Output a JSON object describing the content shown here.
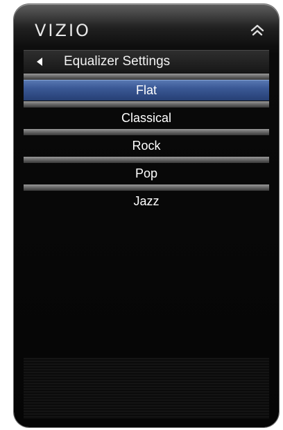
{
  "brand": {
    "logo_text": "VIZIO"
  },
  "header": {
    "title": "Equalizer Settings",
    "back_icon": "back-arrow-icon",
    "home_icon": "home-icon"
  },
  "menu": {
    "selected_index": 0,
    "items": [
      {
        "label": "Flat"
      },
      {
        "label": "Classical"
      },
      {
        "label": "Rock"
      },
      {
        "label": "Pop"
      },
      {
        "label": "Jazz"
      }
    ]
  },
  "colors": {
    "selection": "#3b5996",
    "background": "#050505",
    "text": "#ffffff"
  }
}
